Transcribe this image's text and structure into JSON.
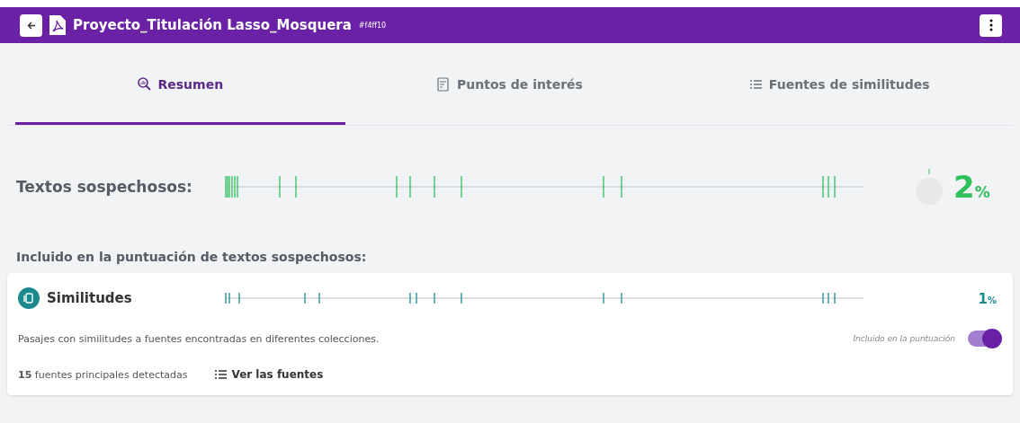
{
  "header": {
    "title": "Proyecto_Titulación Lasso_Mosquera",
    "code": "#f4ff10"
  },
  "tabs": [
    {
      "label": "Resumen",
      "selected": true,
      "kind": "magnifier"
    },
    {
      "label": "Puntos de interés",
      "selected": false,
      "kind": "document"
    },
    {
      "label": "Fuentes de similitudes",
      "selected": false,
      "kind": "list"
    }
  ],
  "summary": {
    "label": "Textos sospechosos:",
    "score": "2",
    "unit": "%"
  },
  "included_heading": "Incluido en la puntuación de textos sospechosos:",
  "similarity_card": {
    "title": "Similitudes",
    "score": "1",
    "unit": "%",
    "description": "Pasajes con similitudes a fuentes encontradas en diferentes colecciones.",
    "toggle_label": "Incluido en la puntuación",
    "toggle_on": true,
    "sources_count": "**15** fuentes principales detectadas",
    "sources_link": "Ver las fuentes"
  }
}
